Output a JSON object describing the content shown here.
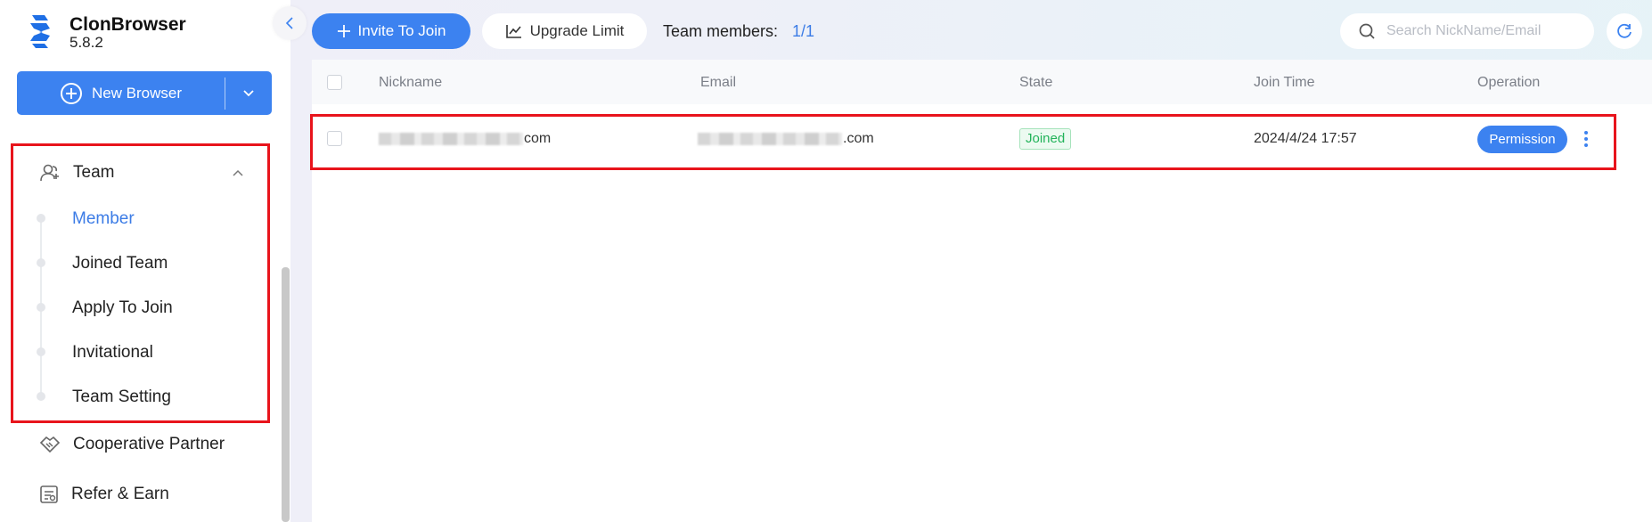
{
  "app": {
    "name": "ClonBrowser",
    "version": "5.8.2"
  },
  "sidebar": {
    "new_browser_label": "New Browser",
    "team": {
      "label": "Team",
      "items": [
        {
          "label": "Member",
          "active": true
        },
        {
          "label": "Joined Team"
        },
        {
          "label": "Apply To Join"
        },
        {
          "label": "Invitational"
        },
        {
          "label": "Team Setting"
        }
      ]
    },
    "cooperative_partner": "Cooperative Partner",
    "refer_earn": "Refer & Earn"
  },
  "toolbar": {
    "invite_label": "Invite To Join",
    "upgrade_label": "Upgrade Limit",
    "members_label": "Team members:",
    "members_value": "1/1",
    "search_placeholder": "Search NickName/Email"
  },
  "table": {
    "columns": [
      "Nickname",
      "Email",
      "State",
      "Join Time",
      "Operation"
    ],
    "rows": [
      {
        "nickname_suffix": "com",
        "email_suffix": ".com",
        "state": "Joined",
        "join_time": "2024/4/24 17:57",
        "operation": "Permission"
      }
    ]
  },
  "colors": {
    "accent": "#3c82f0",
    "highlight_border": "#e8141c",
    "joined": "#22b35a"
  }
}
